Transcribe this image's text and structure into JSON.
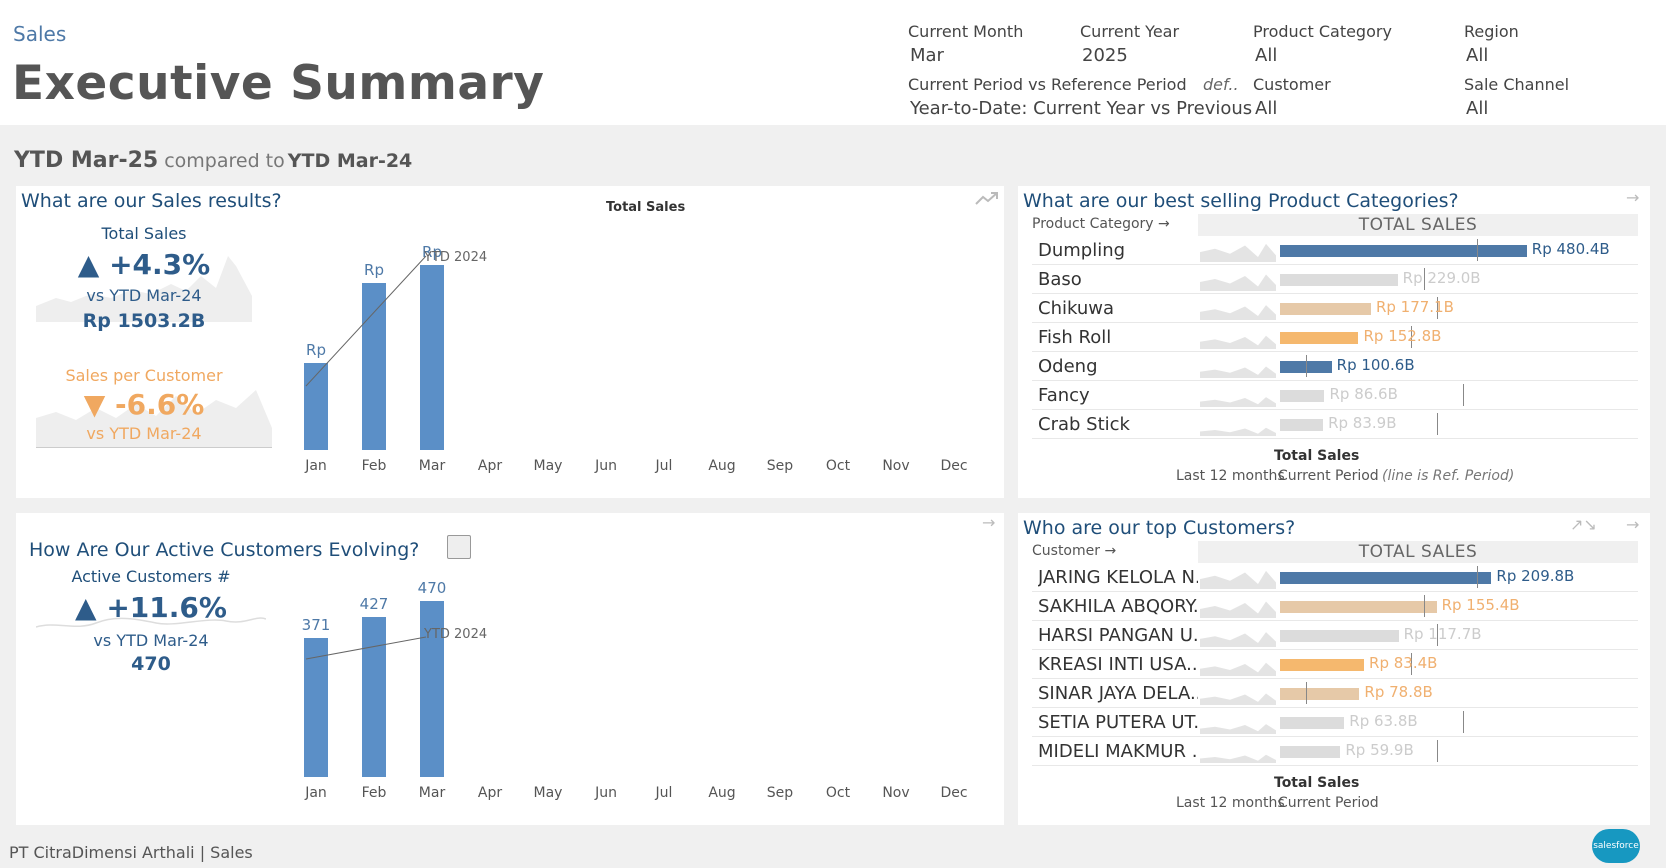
{
  "header": {
    "breadcrumb": "Sales",
    "title": "Executive Summary"
  },
  "filters": {
    "current_month": {
      "label": "Current Month",
      "value": "Mar"
    },
    "current_year": {
      "label": "Current Year",
      "value": "2025"
    },
    "product_category": {
      "label": "Product Category",
      "value": "All"
    },
    "region": {
      "label": "Region",
      "value": "All"
    },
    "period_compare": {
      "label": "Current Period vs Reference Period",
      "value": "Year-to-Date: Current Year vs Previous",
      "def": "def.."
    },
    "customer": {
      "label": "Customer",
      "value": "All"
    },
    "sale_channel": {
      "label": "Sale Channel",
      "value": "All"
    }
  },
  "period": {
    "current": "YTD Mar-25",
    "compared": "compared to",
    "reference": "YTD Mar-24"
  },
  "sales_panel": {
    "title": "What are our Sales results?",
    "kpi_total": {
      "label": "Total Sales",
      "change": "+4.3%",
      "vs": "vs  YTD Mar-24",
      "value": "Rp 1503.2B"
    },
    "kpi_customer": {
      "label": "Sales per Customer",
      "change": "-6.6%",
      "vs": "vs YTD Mar-24"
    },
    "chart_title": "Total Sales",
    "ref_label": "YTD 2024",
    "bar_labels": [
      "Rp",
      "Rp",
      "Rp"
    ]
  },
  "customers_panel": {
    "title": "How Are Our Active Customers Evolving?",
    "kpi": {
      "label": "Active Customers #",
      "change": "+11.6%",
      "vs": "vs YTD Mar-24",
      "value": "470"
    },
    "ref_label": "YTD 2024",
    "bar_labels": [
      "371",
      "427",
      "470"
    ]
  },
  "categories_panel": {
    "title": "What are our best selling Product Categories?",
    "col_name": "Product Category",
    "col_value": "TOTAL SALES",
    "rows": [
      {
        "name": "Dumpling",
        "value": "Rp 480.4B"
      },
      {
        "name": "Baso",
        "value": "Rp 229.0B"
      },
      {
        "name": "Chikuwa",
        "value": "Rp 177.1B"
      },
      {
        "name": "Fish Roll",
        "value": "Rp 152.8B"
      },
      {
        "name": "Odeng",
        "value": "Rp 100.6B"
      },
      {
        "name": "Fancy",
        "value": "Rp 86.6B"
      },
      {
        "name": "Crab Stick",
        "value": "Rp 83.9B"
      }
    ],
    "foot_title": "Total Sales",
    "foot_left": "Last 12 months",
    "foot_mid": "Current Period",
    "foot_note": "(line is Ref. Period)"
  },
  "top_customers_panel": {
    "title": "Who are our top Customers?",
    "col_name": "Customer",
    "col_value": "TOTAL SALES",
    "rows": [
      {
        "name": "JARING KELOLA N..",
        "value": "Rp 209.8B"
      },
      {
        "name": "SAKHILA ABQORY..",
        "value": "Rp 155.4B"
      },
      {
        "name": "HARSI PANGAN U..",
        "value": "Rp 117.7B"
      },
      {
        "name": "KREASI INTI USA..",
        "value": "Rp 83.4B"
      },
      {
        "name": "SINAR JAYA DELA..",
        "value": "Rp 78.8B"
      },
      {
        "name": "SETIA PUTERA UT..",
        "value": "Rp 63.8B"
      },
      {
        "name": "MIDELI MAKMUR ..",
        "value": "Rp 59.9B"
      }
    ],
    "foot_title": "Total Sales",
    "foot_left": "Last 12 months",
    "foot_mid": "Current Period"
  },
  "months": [
    "Jan",
    "Feb",
    "Mar",
    "Apr",
    "May",
    "Jun",
    "Jul",
    "Aug",
    "Sep",
    "Oct",
    "Nov",
    "Dec"
  ],
  "footer": {
    "text": "PT CitraDimensi Arthali | Sales",
    "logo": "salesforce"
  },
  "chart_data": [
    {
      "type": "bar",
      "title": "Total Sales",
      "categories": [
        "Jan",
        "Feb",
        "Mar",
        "Apr",
        "May",
        "Jun",
        "Jul",
        "Aug",
        "Sep",
        "Oct",
        "Nov",
        "Dec"
      ],
      "values": [
        456,
        876,
        971,
        null,
        null,
        null,
        null,
        null,
        null,
        null,
        null,
        null
      ]
    },
    {
      "type": "bar",
      "title": "",
      "categories": [
        "Jan",
        "Feb",
        "Mar",
        "Apr",
        "May",
        "Jun",
        "Jul",
        "Aug",
        "Sep",
        "Oct",
        "Nov",
        "Dec"
      ],
      "values": [
        371,
        427,
        470,
        null,
        null,
        null,
        null,
        null,
        null,
        null,
        null,
        null
      ]
    },
    {
      "type": "bar",
      "title": "TOTAL SALES",
      "categories": [
        "Dumpling",
        "Baso",
        "Chikuwa",
        "Fish Roll",
        "Odeng",
        "Fancy",
        "Crab Stick"
      ],
      "values": [
        480.4,
        229.0,
        177.1,
        152.8,
        100.6,
        86.6,
        83.9
      ],
      "colors": [
        "#4e79a7",
        "#dcdcdc",
        "#e6c9a8",
        "#f5b86e",
        "#4e79a7",
        "#dcdcdc",
        "#dcdcdc"
      ]
    },
    {
      "type": "bar",
      "title": "TOTAL SALES",
      "categories": [
        "JARING KELOLA N..",
        "SAKHILA ABQORY..",
        "HARSI PANGAN U..",
        "KREASI INTI USA..",
        "SINAR JAYA DELA..",
        "SETIA PUTERA UT..",
        "MIDELI MAKMUR .."
      ],
      "values": [
        209.8,
        155.4,
        117.7,
        83.4,
        78.8,
        63.8,
        59.9
      ],
      "colors": [
        "#4e79a7",
        "#e6c9a8",
        "#dcdcdc",
        "#f5b86e",
        "#e6c9a8",
        "#dcdcdc",
        "#dcdcdc"
      ]
    }
  ]
}
